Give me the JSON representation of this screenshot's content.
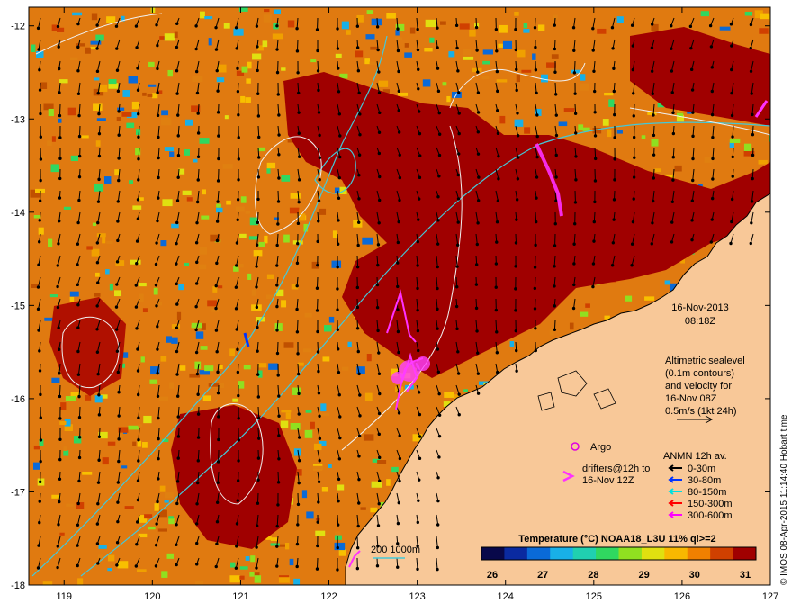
{
  "map": {
    "lon_ticks": [
      "119",
      "120",
      "121",
      "122",
      "123",
      "124",
      "125",
      "126",
      "127"
    ],
    "lat_ticks": [
      "-12",
      "-13",
      "-14",
      "-15",
      "-16",
      "-17",
      "-18"
    ],
    "lon_range": [
      118.6,
      127.0
    ],
    "lat_range": [
      -18.0,
      -11.8
    ]
  },
  "timestamp": {
    "date": "16-Nov-2013",
    "time": "08:18Z"
  },
  "altimetry": {
    "lines": [
      "Altimetric sealevel",
      "(0.1m contours)",
      "and velocity for",
      "16-Nov 08Z",
      "0.5m/s (1kt 24h)"
    ]
  },
  "argo": {
    "label": "Argo",
    "color": "#e000e0"
  },
  "drifters": {
    "lines": [
      "drifters@12h to",
      "16-Nov 12Z"
    ],
    "color": "#ff30ff"
  },
  "anmn": {
    "title": "ANMN 12h av.",
    "items": [
      {
        "label": "0-30m",
        "color": "#000000"
      },
      {
        "label": "30-80m",
        "color": "#0033ff"
      },
      {
        "label": "80-150m",
        "color": "#00e0e0"
      },
      {
        "label": "150-300m",
        "color": "#ff0000"
      },
      {
        "label": "300-600m",
        "color": "#ff00ff"
      }
    ]
  },
  "isobath_label": "200  1000m",
  "colorbar": {
    "title": "Temperature (°C) NOAA18_L3U 11% ql>=2",
    "ticks": [
      "26",
      "27",
      "28",
      "29",
      "30",
      "31"
    ],
    "colors": [
      "#08084a",
      "#0a2aa0",
      "#0a6ad8",
      "#18b0e8",
      "#20d0b0",
      "#30d860",
      "#90e020",
      "#e0e010",
      "#f8b800",
      "#f08000",
      "#d04000",
      "#a00000"
    ]
  },
  "credit": "© IMOS 08-Apr-2015 11:14:40 Hobart time"
}
